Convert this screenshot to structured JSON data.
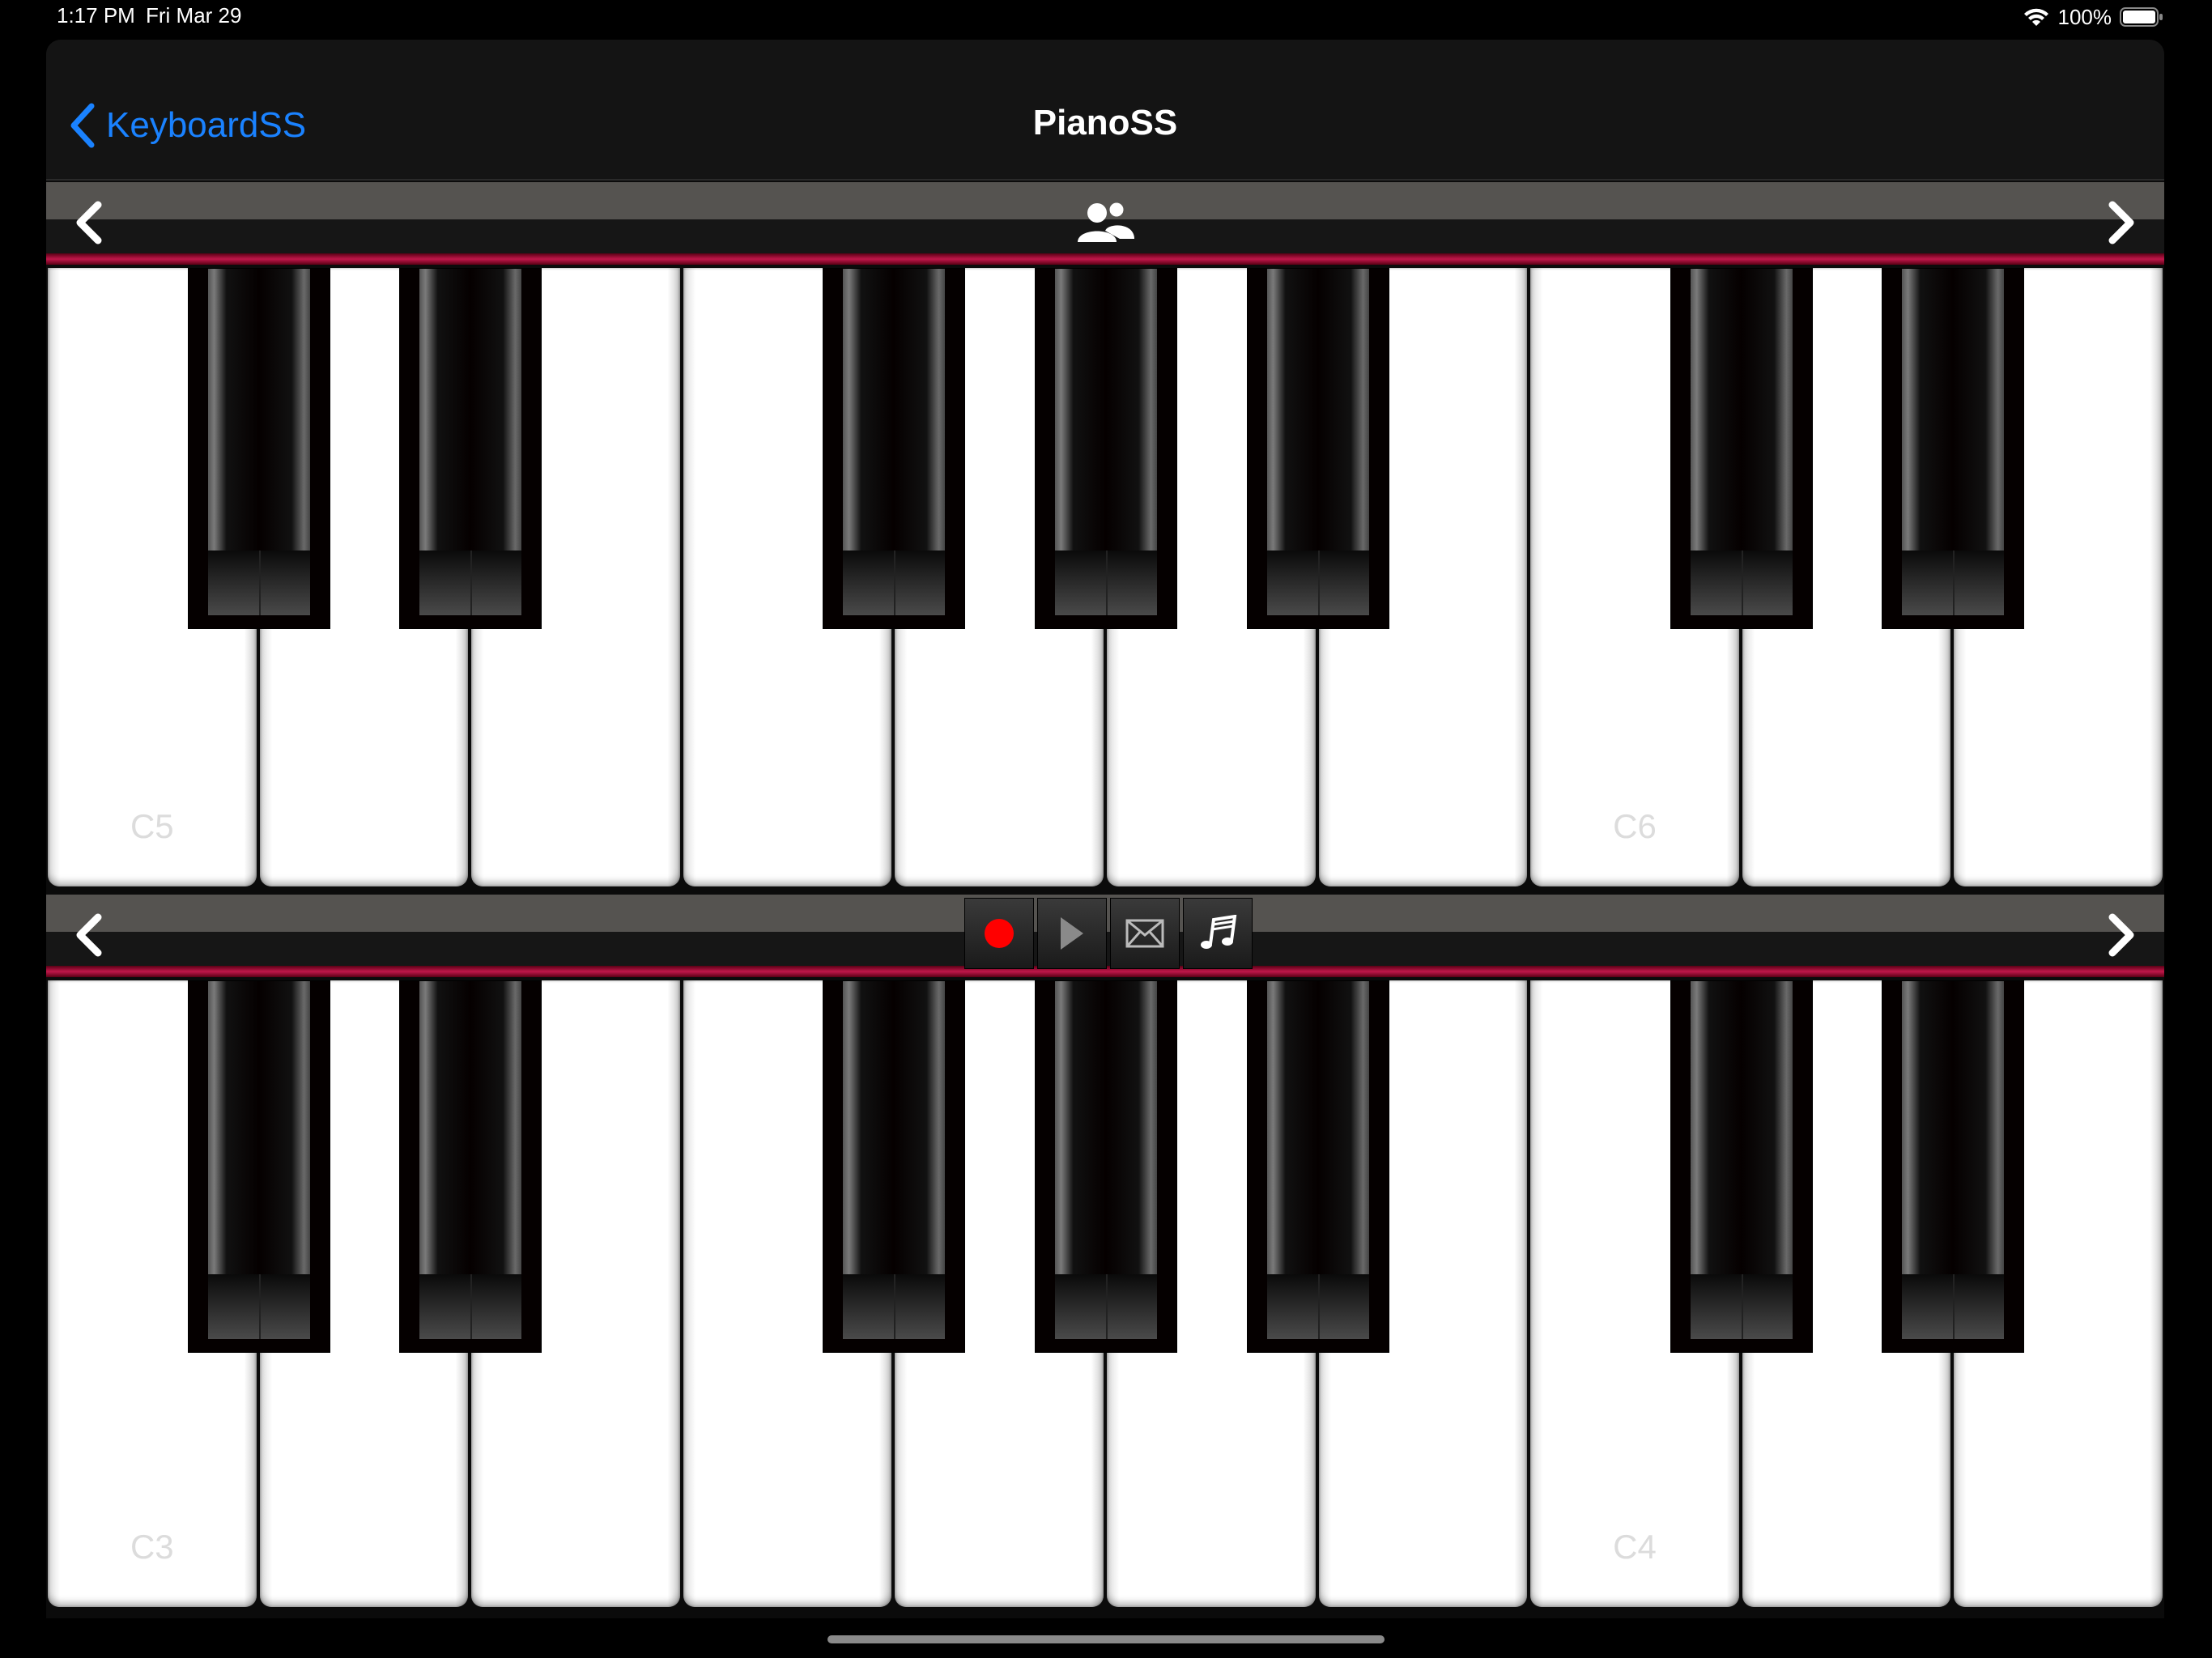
{
  "status_bar": {
    "time": "1:17 PM",
    "date": "Fri Mar 29",
    "battery": "100%"
  },
  "nav": {
    "back_label": "KeyboardSS",
    "title": "PianoSS"
  },
  "upper_keyboard": {
    "labels": [
      "C5",
      "",
      "",
      "",
      "",
      "",
      "",
      "C6",
      "",
      ""
    ]
  },
  "lower_keyboard": {
    "labels": [
      "C3",
      "",
      "",
      "",
      "",
      "",
      "",
      "C4",
      "",
      ""
    ]
  },
  "transport": {
    "record_color": "#ff0000"
  },
  "colors": {
    "accent": "#1a82ff",
    "rail": "#c0174a"
  }
}
